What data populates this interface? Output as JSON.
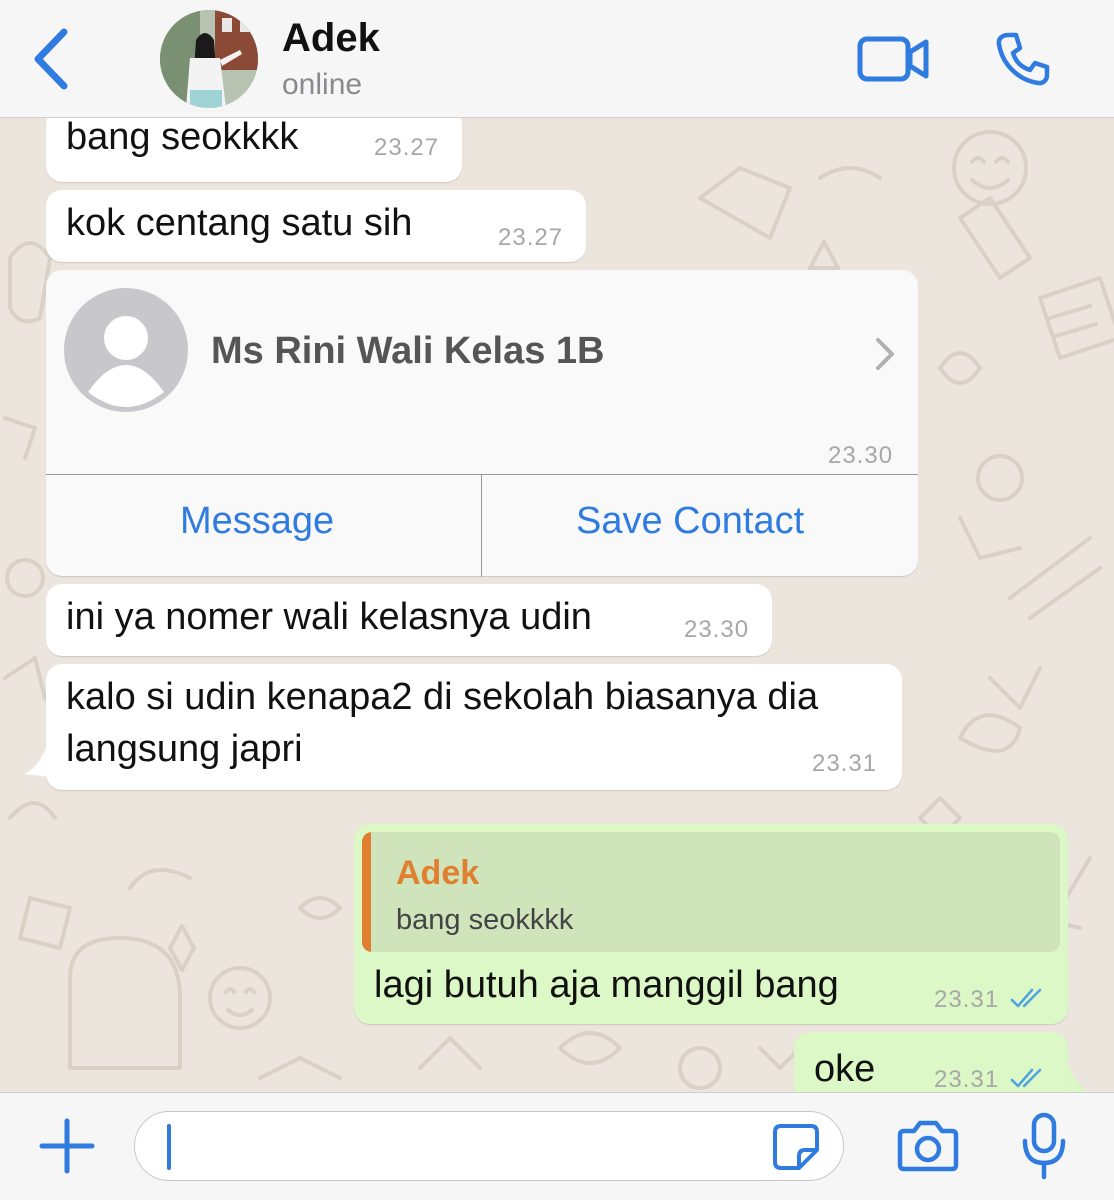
{
  "header": {
    "contact_name": "Adek",
    "status": "online",
    "icons": {
      "back": "chevron-left-icon",
      "video": "video-camera-icon",
      "call": "phone-icon"
    }
  },
  "messages": [
    {
      "direction": "incoming",
      "text": "bang seokkkk",
      "time": "23.27"
    },
    {
      "direction": "incoming",
      "text": "kok centang satu sih",
      "time": "23.27"
    },
    {
      "direction": "incoming",
      "type": "contact-card",
      "contact_name": "Ms Rini Wali Kelas 1B",
      "time": "23.30",
      "actions": [
        "Message",
        "Save Contact"
      ]
    },
    {
      "direction": "incoming",
      "text": "ini ya nomer wali kelasnya udin",
      "time": "23.30"
    },
    {
      "direction": "incoming",
      "lines": [
        "kalo si udin kenapa2 di sekolah biasanya dia",
        "langsung japri"
      ],
      "time": "23.31"
    },
    {
      "direction": "outgoing",
      "reply_to": {
        "author": "Adek",
        "text": "bang seokkkk"
      },
      "text": "lagi butuh aja manggil bang",
      "time": "23.31",
      "status": "read"
    },
    {
      "direction": "outgoing",
      "text": "oke",
      "time": "23.31",
      "status": "read"
    }
  ],
  "colors": {
    "accent": "#2F7BE0",
    "outgoing_bubble": "#DCF8C6",
    "incoming_bubble": "#FFFFFF",
    "chat_background": "#ECE5DD",
    "reply_bar": "#E07F30",
    "read_ticks": "#4FA3E3"
  },
  "composer": {
    "value": "",
    "icons": {
      "add": "plus-icon",
      "sticker": "sticker-icon",
      "camera": "camera-icon",
      "mic": "microphone-icon"
    }
  }
}
